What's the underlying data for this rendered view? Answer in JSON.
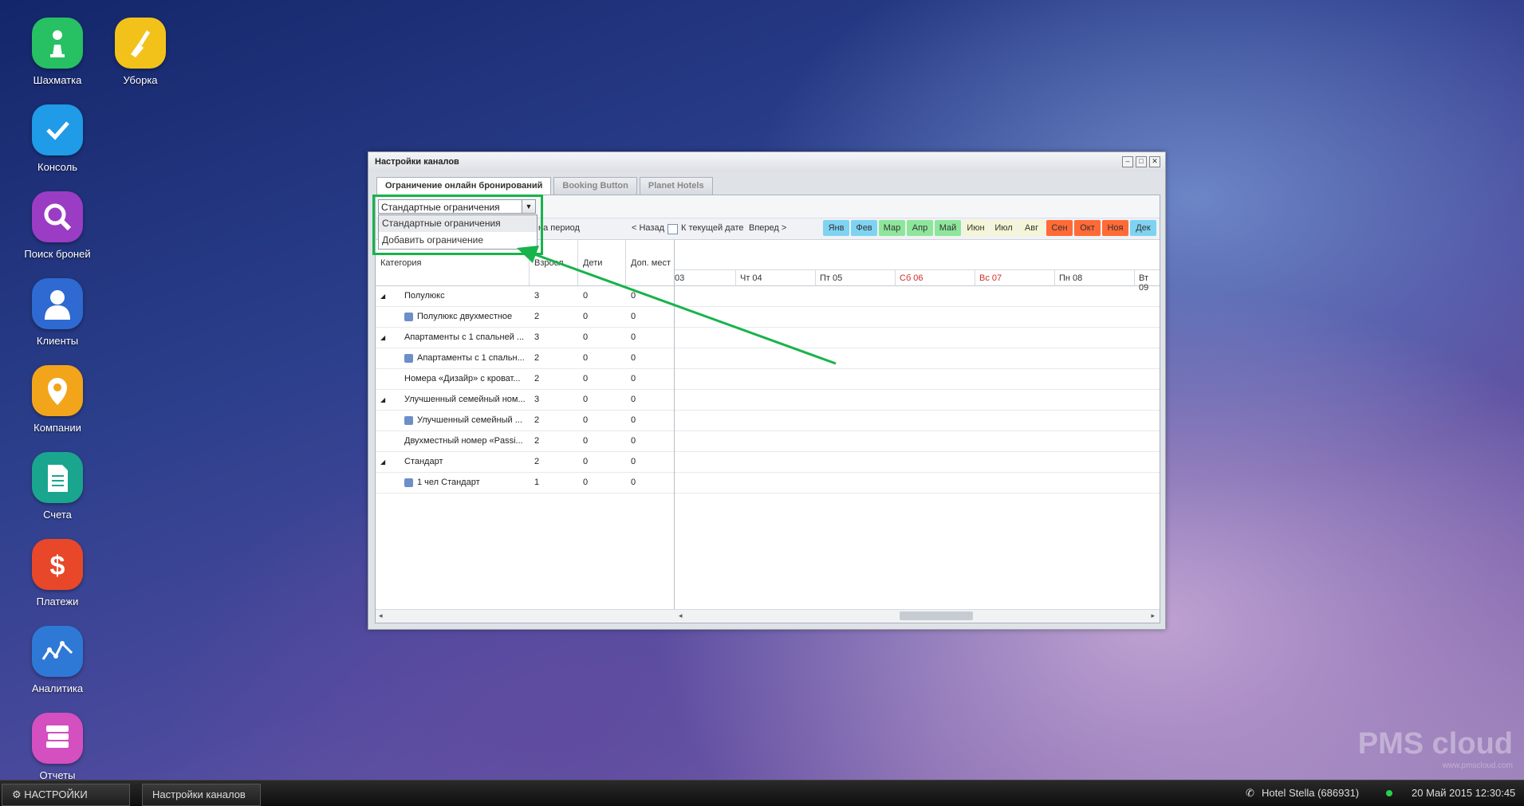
{
  "desktop": {
    "icons": [
      {
        "label": "Шахматка",
        "icon": "chess-pawn-icon",
        "color": "#27c063"
      },
      {
        "label": "Уборка",
        "icon": "broom-icon",
        "color": "#f2c21b"
      },
      {
        "label": "Консоль",
        "icon": "checkmark-icon",
        "color": "#1f9be8"
      },
      {
        "label": "Поиск броней",
        "icon": "search-icon",
        "color": "#9b3cc4"
      },
      {
        "label": "Клиенты",
        "icon": "person-icon",
        "color": "#2e6ad1"
      },
      {
        "label": "Компании",
        "icon": "map-pin-icon",
        "color": "#f2a51b"
      },
      {
        "label": "Счета",
        "icon": "document-icon",
        "color": "#1aa58f"
      },
      {
        "label": "Платежи",
        "icon": "dollar-icon",
        "color": "#e9472a"
      },
      {
        "label": "Аналитика",
        "icon": "chart-icon",
        "color": "#2f79d6"
      },
      {
        "label": "Отчеты",
        "icon": "books-icon",
        "color": "#d44fc0"
      }
    ]
  },
  "window": {
    "title": "Настройки каналов",
    "tabs": [
      {
        "label": "Ограничение онлайн бронирований",
        "active": true
      },
      {
        "label": "Booking Button",
        "active": false
      },
      {
        "label": "Planet Hotels",
        "active": false
      }
    ],
    "combo": {
      "value": "Стандартные ограничения"
    },
    "dropdown": [
      "Стандартные ограничения",
      "Добавить ограничение"
    ],
    "toolbar": {
      "period_label": "на период",
      "back_label": "< Назад",
      "today_label": "К текущей дате",
      "forward_label": "Вперед >"
    },
    "months": [
      {
        "label": "Янв",
        "color": "#7fd3f2"
      },
      {
        "label": "Фев",
        "color": "#7fd3f2"
      },
      {
        "label": "Мар",
        "color": "#8ee69b"
      },
      {
        "label": "Апр",
        "color": "#8ee69b"
      },
      {
        "label": "Май",
        "color": "#8ee69b"
      },
      {
        "label": "Июн",
        "color": "#f4f5d6"
      },
      {
        "label": "Июл",
        "color": "#f4f5d6"
      },
      {
        "label": "Авг",
        "color": "#f4f5d6"
      },
      {
        "label": "Сен",
        "color": "#ff6a36"
      },
      {
        "label": "Окт",
        "color": "#ff6a36"
      },
      {
        "label": "Ноя",
        "color": "#ff6a36"
      },
      {
        "label": "Дек",
        "color": "#7fd3f2"
      }
    ],
    "columns": {
      "category": "Категория",
      "adults": "Взросл",
      "children": "Дети",
      "extra": "Доп. мест"
    },
    "dates": [
      {
        "label": "03",
        "weekend": false
      },
      {
        "label": "Чт 04",
        "weekend": false
      },
      {
        "label": "Пт 05",
        "weekend": false
      },
      {
        "label": "Сб 06",
        "weekend": true
      },
      {
        "label": "Вс 07",
        "weekend": true
      },
      {
        "label": "Пн 08",
        "weekend": false
      },
      {
        "label": "Вт 09",
        "weekend": false
      }
    ],
    "rows": [
      {
        "name": "Полулюкс",
        "adults": "3",
        "children": "0",
        "extra": "0",
        "level": 0,
        "expandable": true
      },
      {
        "name": "Полулюкс двухместное",
        "adults": "2",
        "children": "0",
        "extra": "0",
        "level": 1,
        "icon": true
      },
      {
        "name": "Апартаменты с 1 спальней ...",
        "adults": "3",
        "children": "0",
        "extra": "0",
        "level": 0,
        "expandable": true
      },
      {
        "name": "Апартаменты с 1 спальн...",
        "adults": "2",
        "children": "0",
        "extra": "0",
        "level": 1,
        "icon": true
      },
      {
        "name": "Номера «Дизайр» с кроват...",
        "adults": "2",
        "children": "0",
        "extra": "0",
        "level": 0,
        "expandable": false
      },
      {
        "name": "Улучшенный семейный ном...",
        "adults": "3",
        "children": "0",
        "extra": "0",
        "level": 0,
        "expandable": true
      },
      {
        "name": "Улучшенный семейный ...",
        "adults": "2",
        "children": "0",
        "extra": "0",
        "level": 1,
        "icon": true
      },
      {
        "name": "Двухместный номер «Passi...",
        "adults": "2",
        "children": "0",
        "extra": "0",
        "level": 0,
        "expandable": false
      },
      {
        "name": "Стандарт",
        "adults": "2",
        "children": "0",
        "extra": "0",
        "level": 0,
        "expandable": true
      },
      {
        "name": "1 чел Стандарт",
        "adults": "1",
        "children": "0",
        "extra": "0",
        "level": 1,
        "icon": true
      }
    ]
  },
  "taskbar": {
    "start_label": "НАСТРОЙКИ",
    "window_label": "Настройки каналов",
    "hotel": "Hotel Stella (686931)",
    "datetime": "20 Май 2015 12:30:45"
  },
  "watermark": {
    "brand": "PMS cloud",
    "url": "www.pmscloud.com"
  }
}
